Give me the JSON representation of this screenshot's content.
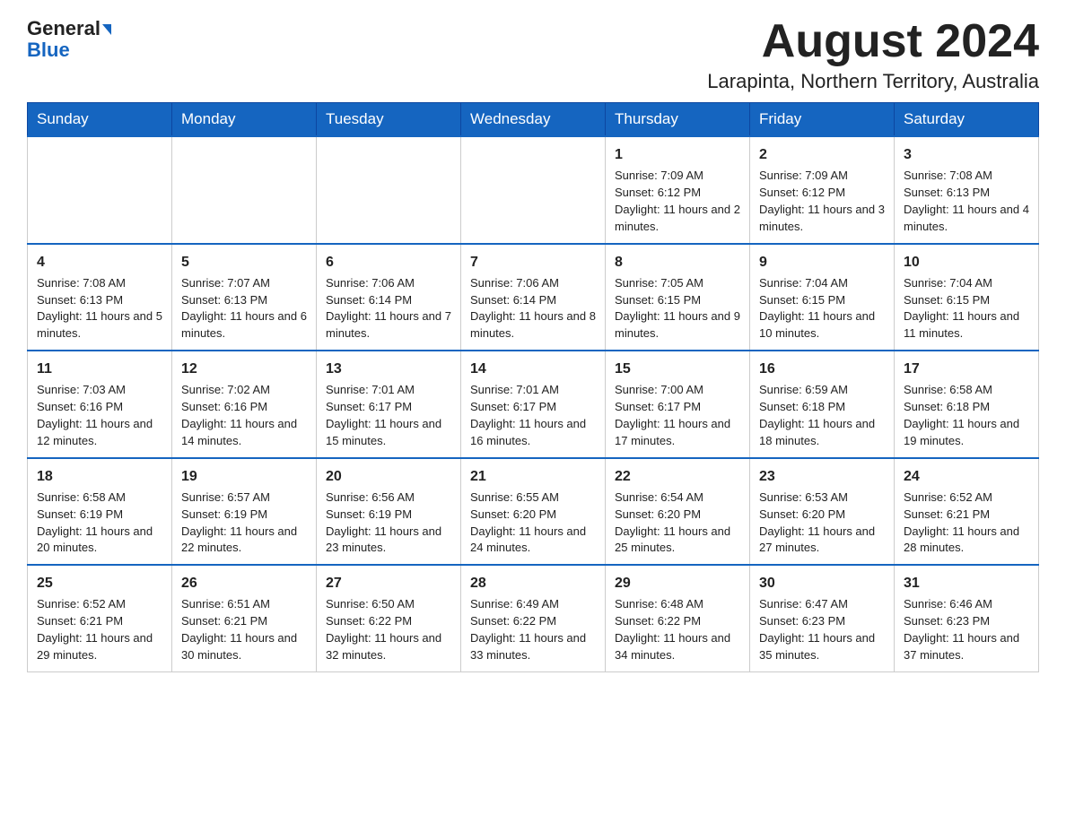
{
  "header": {
    "logo_line1": "General",
    "logo_line2": "Blue",
    "title": "August 2024",
    "subtitle": "Larapinta, Northern Territory, Australia"
  },
  "weekdays": [
    "Sunday",
    "Monday",
    "Tuesday",
    "Wednesday",
    "Thursday",
    "Friday",
    "Saturday"
  ],
  "weeks": [
    [
      {
        "day": "",
        "info": ""
      },
      {
        "day": "",
        "info": ""
      },
      {
        "day": "",
        "info": ""
      },
      {
        "day": "",
        "info": ""
      },
      {
        "day": "1",
        "info": "Sunrise: 7:09 AM\nSunset: 6:12 PM\nDaylight: 11 hours and 2 minutes."
      },
      {
        "day": "2",
        "info": "Sunrise: 7:09 AM\nSunset: 6:12 PM\nDaylight: 11 hours and 3 minutes."
      },
      {
        "day": "3",
        "info": "Sunrise: 7:08 AM\nSunset: 6:13 PM\nDaylight: 11 hours and 4 minutes."
      }
    ],
    [
      {
        "day": "4",
        "info": "Sunrise: 7:08 AM\nSunset: 6:13 PM\nDaylight: 11 hours and 5 minutes."
      },
      {
        "day": "5",
        "info": "Sunrise: 7:07 AM\nSunset: 6:13 PM\nDaylight: 11 hours and 6 minutes."
      },
      {
        "day": "6",
        "info": "Sunrise: 7:06 AM\nSunset: 6:14 PM\nDaylight: 11 hours and 7 minutes."
      },
      {
        "day": "7",
        "info": "Sunrise: 7:06 AM\nSunset: 6:14 PM\nDaylight: 11 hours and 8 minutes."
      },
      {
        "day": "8",
        "info": "Sunrise: 7:05 AM\nSunset: 6:15 PM\nDaylight: 11 hours and 9 minutes."
      },
      {
        "day": "9",
        "info": "Sunrise: 7:04 AM\nSunset: 6:15 PM\nDaylight: 11 hours and 10 minutes."
      },
      {
        "day": "10",
        "info": "Sunrise: 7:04 AM\nSunset: 6:15 PM\nDaylight: 11 hours and 11 minutes."
      }
    ],
    [
      {
        "day": "11",
        "info": "Sunrise: 7:03 AM\nSunset: 6:16 PM\nDaylight: 11 hours and 12 minutes."
      },
      {
        "day": "12",
        "info": "Sunrise: 7:02 AM\nSunset: 6:16 PM\nDaylight: 11 hours and 14 minutes."
      },
      {
        "day": "13",
        "info": "Sunrise: 7:01 AM\nSunset: 6:17 PM\nDaylight: 11 hours and 15 minutes."
      },
      {
        "day": "14",
        "info": "Sunrise: 7:01 AM\nSunset: 6:17 PM\nDaylight: 11 hours and 16 minutes."
      },
      {
        "day": "15",
        "info": "Sunrise: 7:00 AM\nSunset: 6:17 PM\nDaylight: 11 hours and 17 minutes."
      },
      {
        "day": "16",
        "info": "Sunrise: 6:59 AM\nSunset: 6:18 PM\nDaylight: 11 hours and 18 minutes."
      },
      {
        "day": "17",
        "info": "Sunrise: 6:58 AM\nSunset: 6:18 PM\nDaylight: 11 hours and 19 minutes."
      }
    ],
    [
      {
        "day": "18",
        "info": "Sunrise: 6:58 AM\nSunset: 6:19 PM\nDaylight: 11 hours and 20 minutes."
      },
      {
        "day": "19",
        "info": "Sunrise: 6:57 AM\nSunset: 6:19 PM\nDaylight: 11 hours and 22 minutes."
      },
      {
        "day": "20",
        "info": "Sunrise: 6:56 AM\nSunset: 6:19 PM\nDaylight: 11 hours and 23 minutes."
      },
      {
        "day": "21",
        "info": "Sunrise: 6:55 AM\nSunset: 6:20 PM\nDaylight: 11 hours and 24 minutes."
      },
      {
        "day": "22",
        "info": "Sunrise: 6:54 AM\nSunset: 6:20 PM\nDaylight: 11 hours and 25 minutes."
      },
      {
        "day": "23",
        "info": "Sunrise: 6:53 AM\nSunset: 6:20 PM\nDaylight: 11 hours and 27 minutes."
      },
      {
        "day": "24",
        "info": "Sunrise: 6:52 AM\nSunset: 6:21 PM\nDaylight: 11 hours and 28 minutes."
      }
    ],
    [
      {
        "day": "25",
        "info": "Sunrise: 6:52 AM\nSunset: 6:21 PM\nDaylight: 11 hours and 29 minutes."
      },
      {
        "day": "26",
        "info": "Sunrise: 6:51 AM\nSunset: 6:21 PM\nDaylight: 11 hours and 30 minutes."
      },
      {
        "day": "27",
        "info": "Sunrise: 6:50 AM\nSunset: 6:22 PM\nDaylight: 11 hours and 32 minutes."
      },
      {
        "day": "28",
        "info": "Sunrise: 6:49 AM\nSunset: 6:22 PM\nDaylight: 11 hours and 33 minutes."
      },
      {
        "day": "29",
        "info": "Sunrise: 6:48 AM\nSunset: 6:22 PM\nDaylight: 11 hours and 34 minutes."
      },
      {
        "day": "30",
        "info": "Sunrise: 6:47 AM\nSunset: 6:23 PM\nDaylight: 11 hours and 35 minutes."
      },
      {
        "day": "31",
        "info": "Sunrise: 6:46 AM\nSunset: 6:23 PM\nDaylight: 11 hours and 37 minutes."
      }
    ]
  ]
}
